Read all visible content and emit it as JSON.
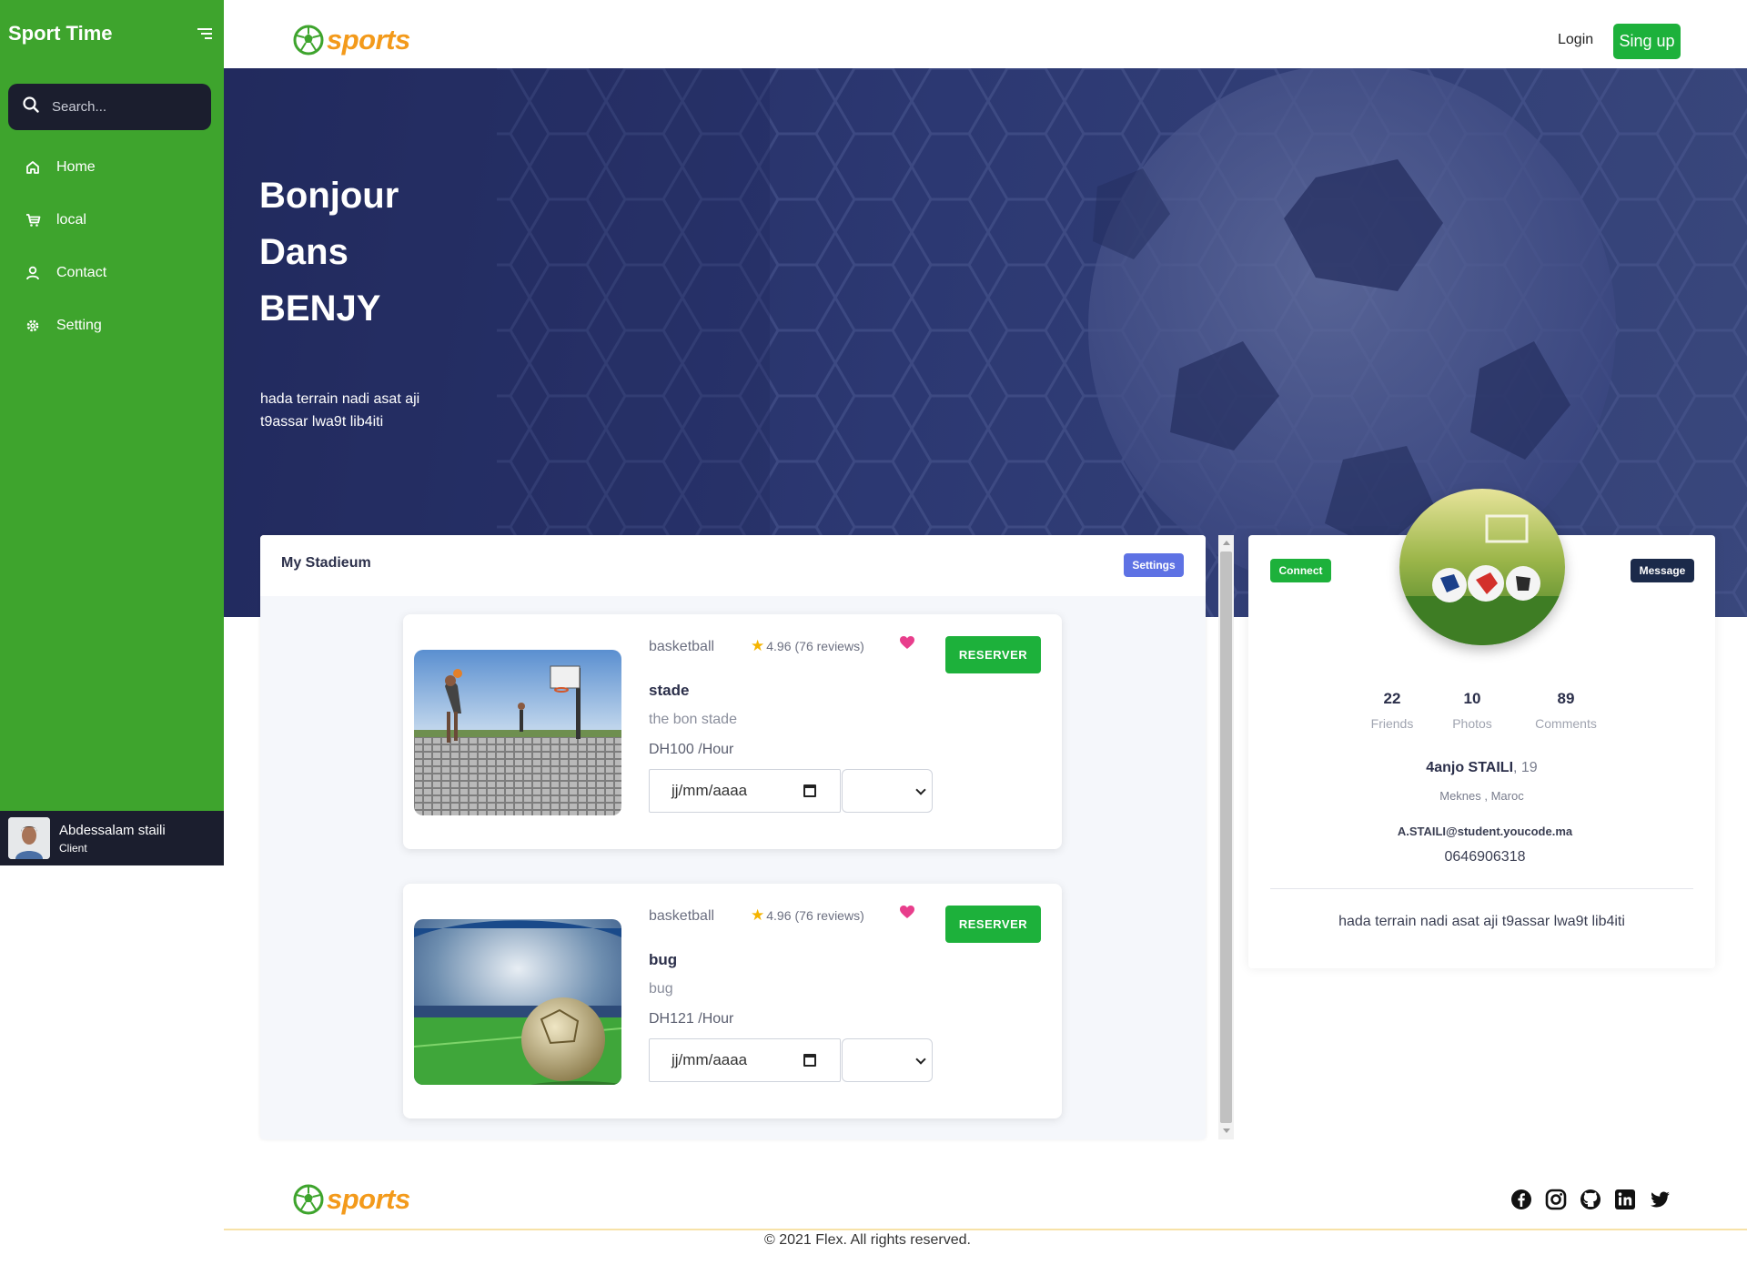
{
  "sidebar": {
    "title": "Sport Time",
    "search_placeholder": "Search...",
    "items": [
      {
        "label": "Home",
        "icon": "home-icon"
      },
      {
        "label": "local",
        "icon": "cart-icon"
      },
      {
        "label": "Contact",
        "icon": "user-icon"
      },
      {
        "label": "Setting",
        "icon": "gear-icon"
      }
    ],
    "user": {
      "name": "Abdessalam staili",
      "role": "Client"
    }
  },
  "header": {
    "logo_text": "sports",
    "login_label": "Login",
    "signup_label": "Sing up"
  },
  "hero": {
    "lines": [
      "Bonjour",
      "Dans",
      "BENJY"
    ],
    "subtitle": "hada terrain nadi asat aji t9assar lwa9t lib4iti"
  },
  "stadium_panel": {
    "title": "My Stadieum",
    "settings_label": "Settings",
    "items": [
      {
        "category": "basketball",
        "rating": "4.96",
        "reviews": "(76 reviews)",
        "name": "stade",
        "description": "the bon stade",
        "price": "DH100 /Hour",
        "date_placeholder": "jj/mm/aaaa",
        "reserve_label": "RESERVER"
      },
      {
        "category": "basketball",
        "rating": "4.96",
        "reviews": "(76 reviews)",
        "name": "bug",
        "description": "bug",
        "price": "DH121 /Hour",
        "date_placeholder": "jj/mm/aaaa",
        "reserve_label": "RESERVER"
      }
    ]
  },
  "profile": {
    "connect_label": "Connect",
    "message_label": "Message",
    "stats": [
      {
        "value": "22",
        "label": "Friends"
      },
      {
        "value": "10",
        "label": "Photos"
      },
      {
        "value": "89",
        "label": "Comments"
      }
    ],
    "name": "4anjo STAILI",
    "age": ", 19",
    "location": "Meknes , Maroc",
    "email": "A.STAILI@student.youcode.ma",
    "phone": "0646906318",
    "bio": "hada terrain nadi asat aji t9assar lwa9t lib4iti"
  },
  "footer": {
    "logo_text": "sports",
    "copyright": "© 2021 Flex. All rights reserved.",
    "social": [
      "facebook-icon",
      "instagram-icon",
      "github-icon",
      "linkedin-icon",
      "twitter-icon"
    ]
  },
  "colors": {
    "sidebar_green": "#3ea42d",
    "dark_navy": "#1b1e2e",
    "accent_green": "#1db13b",
    "hero_blue": "#283268",
    "settings_blue": "#5e72e4",
    "logo_orange": "#f39a1b"
  }
}
